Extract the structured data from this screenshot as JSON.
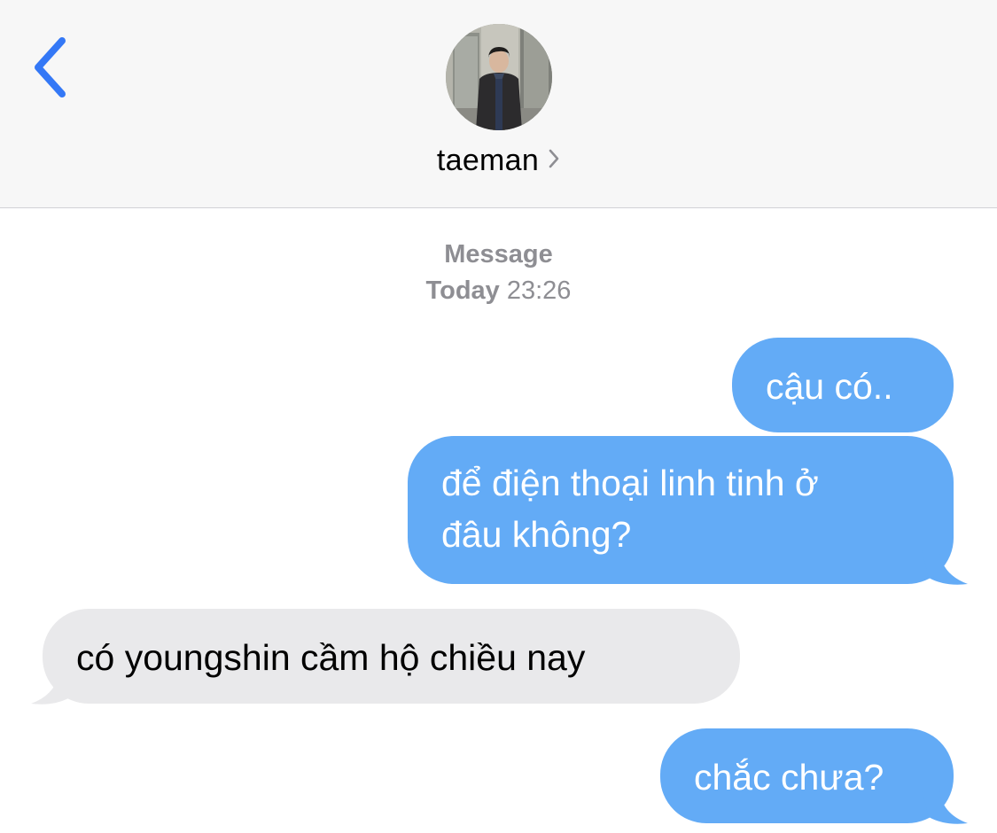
{
  "header": {
    "back_icon": "chevron-left-icon",
    "contact_name": "taeman",
    "contact_chevron_icon": "chevron-right-icon",
    "colors": {
      "accent": "#3478f6",
      "header_bg": "#f7f7f7"
    }
  },
  "conversation": {
    "service_label": "Message",
    "day_label": "Today",
    "time_label": "23:26",
    "messages": [
      {
        "direction": "sent",
        "text": "cậu có.."
      },
      {
        "direction": "sent",
        "text_line1": "để điện thoại linh tinh ở",
        "text_line2": "đâu không?"
      },
      {
        "direction": "received",
        "text": "có youngshin cầm hộ chiều nay"
      },
      {
        "direction": "sent",
        "text": "chắc chưa?"
      }
    ],
    "colors": {
      "sent_bubble": "#63abf6",
      "received_bubble": "#e9e9eb",
      "meta_text": "#8e8e93"
    }
  }
}
